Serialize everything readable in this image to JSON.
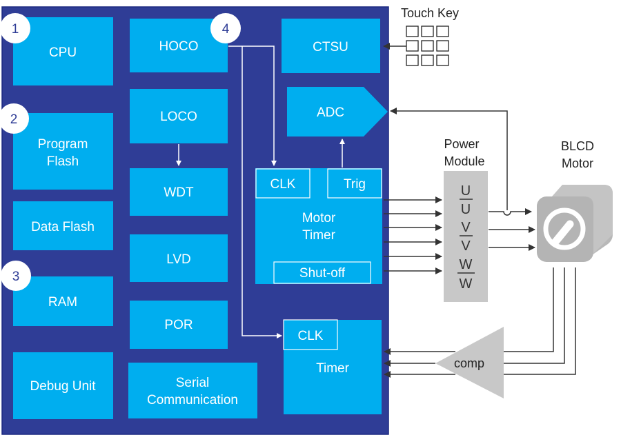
{
  "badges": [
    "1",
    "2",
    "3",
    "4"
  ],
  "blocks": {
    "cpu": "CPU",
    "program_flash": [
      "Program",
      "Flash"
    ],
    "data_flash": "Data Flash",
    "ram": "RAM",
    "debug_unit": "Debug Unit",
    "hoco": "HOCO",
    "loco": "LOCO",
    "wdt": "WDT",
    "lvd": "LVD",
    "por": "POR",
    "serial_communication": [
      "Serial",
      "Communication"
    ],
    "ctsu": "CTSU",
    "adc": "ADC",
    "motor_timer": {
      "title": [
        "Motor",
        "Timer"
      ],
      "clk": "CLK",
      "trig": "Trig",
      "shutoff": "Shut-off"
    },
    "timer": {
      "title": "Timer",
      "clk": "CLK"
    }
  },
  "external": {
    "touch_key": "Touch Key",
    "power_module": {
      "title": [
        "Power",
        "Module"
      ],
      "phases": [
        "U",
        "U",
        "V",
        "V",
        "W",
        "W"
      ]
    },
    "motor": [
      "BLCD",
      "Motor"
    ],
    "comparator": "comp"
  },
  "colors": {
    "chip_bg": "#2f3d96",
    "block": "#00aeef",
    "power_module": "#c8c8c8"
  }
}
